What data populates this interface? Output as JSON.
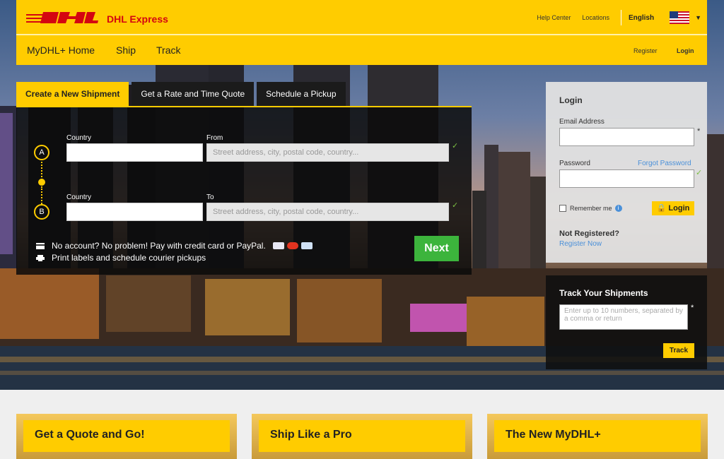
{
  "header": {
    "brand": "DHL Express",
    "top_links": [
      "Help Center",
      "Locations"
    ],
    "language": "English",
    "nav": [
      "MyDHL+ Home",
      "Ship",
      "Track"
    ],
    "register": "Register",
    "login": "Login"
  },
  "shipment": {
    "tabs": [
      "Create a New Shipment",
      "Get a Rate and Time Quote",
      "Schedule a Pickup"
    ],
    "from": {
      "marker": "A",
      "country_label": "Country",
      "address_label": "From",
      "address_placeholder": "Street address, city, postal code, country..."
    },
    "to": {
      "marker": "B",
      "country_label": "Country",
      "address_label": "To",
      "address_placeholder": "Street address, city, postal code, country..."
    },
    "info_1": "No account? No problem! Pay with credit card or PayPal.",
    "info_2": "Print labels and schedule courier pickups",
    "next": "Next"
  },
  "login_panel": {
    "title": "Login",
    "email_label": "Email Address",
    "password_label": "Password",
    "forgot": "Forgot Password",
    "remember": "Remember me",
    "login_button": "Login",
    "not_registered": "Not Registered?",
    "register_now": "Register Now",
    "required_mark": "*"
  },
  "track_panel": {
    "title": "Track Your Shipments",
    "placeholder": "Enter up to 10 numbers, separated by a comma or return",
    "button": "Track",
    "required_mark": "*"
  },
  "promos": [
    "Get a Quote and Go!",
    "Ship Like a Pro",
    "The New MyDHL+"
  ],
  "colors": {
    "dhl_yellow": "#ffcc00",
    "dhl_red": "#d40511",
    "next_green": "#3cb43c",
    "link_blue": "#4a90d9"
  }
}
